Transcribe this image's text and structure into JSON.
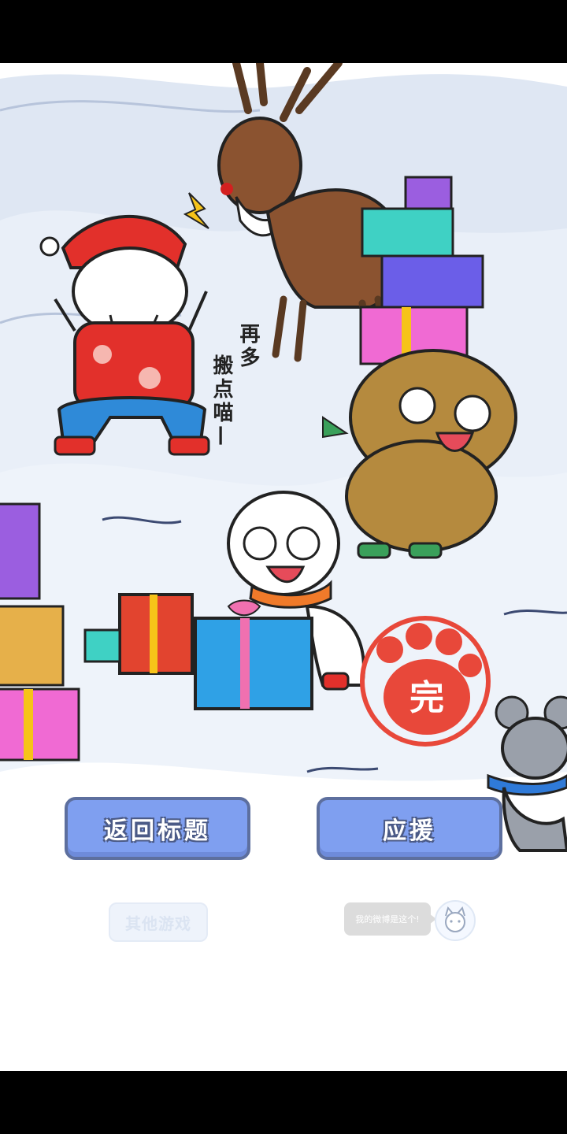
{
  "speech": {
    "col1": "再多",
    "col2": "搬点喵—"
  },
  "stamp": {
    "label": "完"
  },
  "buttons": {
    "back_title": "返回标题",
    "cheer": "应援",
    "other_games": "其他游戏"
  },
  "promo": {
    "bubble_text": "我的微博是这个!"
  },
  "colors": {
    "button_blue": "#7f9ff0",
    "stamp_red": "#e8483a",
    "snow": "#e6edf7"
  }
}
